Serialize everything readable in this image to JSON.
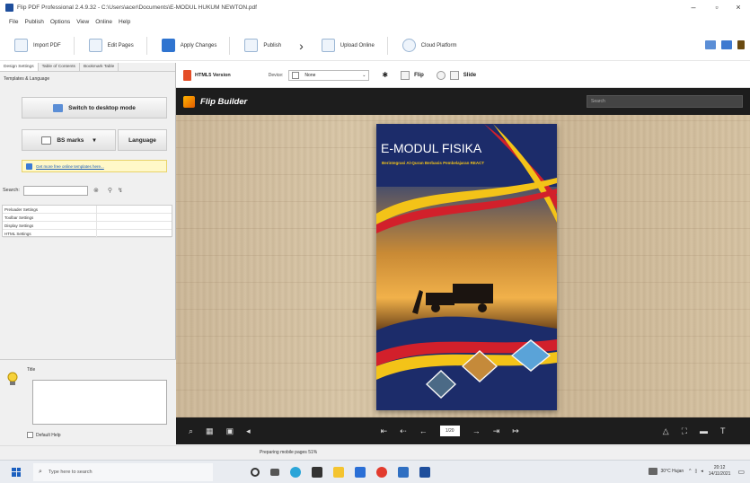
{
  "window": {
    "title": "Flip PDF Professional 2.4.9.32 - C:\\Users\\acer\\Documents\\E-MODUL HUKUM NEWTON.pdf",
    "min": "–",
    "max": "▫",
    "close": "×"
  },
  "menu": [
    "File",
    "Publish",
    "Options",
    "View",
    "Online",
    "Help"
  ],
  "toolbar": {
    "import": "Import PDF",
    "edit": "Edit Pages",
    "apply": "Apply Changes",
    "publish": "Publish",
    "upload": "Upload Online",
    "cloud": "Cloud Platform"
  },
  "left": {
    "tabs": [
      "Design Settings",
      "Table of Contents",
      "Bookmark Table"
    ],
    "template_label": "Templates & Language",
    "switch_btn": "Switch to desktop mode",
    "bg_btn": "BS marks",
    "lang_btn": "Language",
    "link": "Get more free online templates here...",
    "search_label": "Search:",
    "props": [
      "Preloader Settings",
      "Toolbar Settings",
      "Display Settings",
      "HTML Settings"
    ],
    "tip_title": "Title",
    "default_help": "Default Help"
  },
  "preview": {
    "html5": "HTML5 Version",
    "device_label": "Device:",
    "device_value": "None",
    "flip": "Flip",
    "slide": "Slide"
  },
  "flip": {
    "brand": "Flip Builder",
    "search_placeholder": "Search",
    "page": "1/20"
  },
  "cover": {
    "title": "E-MODUL FISIKA",
    "subtitle": "Berintegrasi Al-Quran Berbasis Pembelajaran REACT"
  },
  "status": "Preparing mobile pages 51%",
  "taskbar": {
    "search": "Type here to search",
    "temp": "30°C Hujan",
    "time": "20:12",
    "date": "14/11/2021"
  }
}
